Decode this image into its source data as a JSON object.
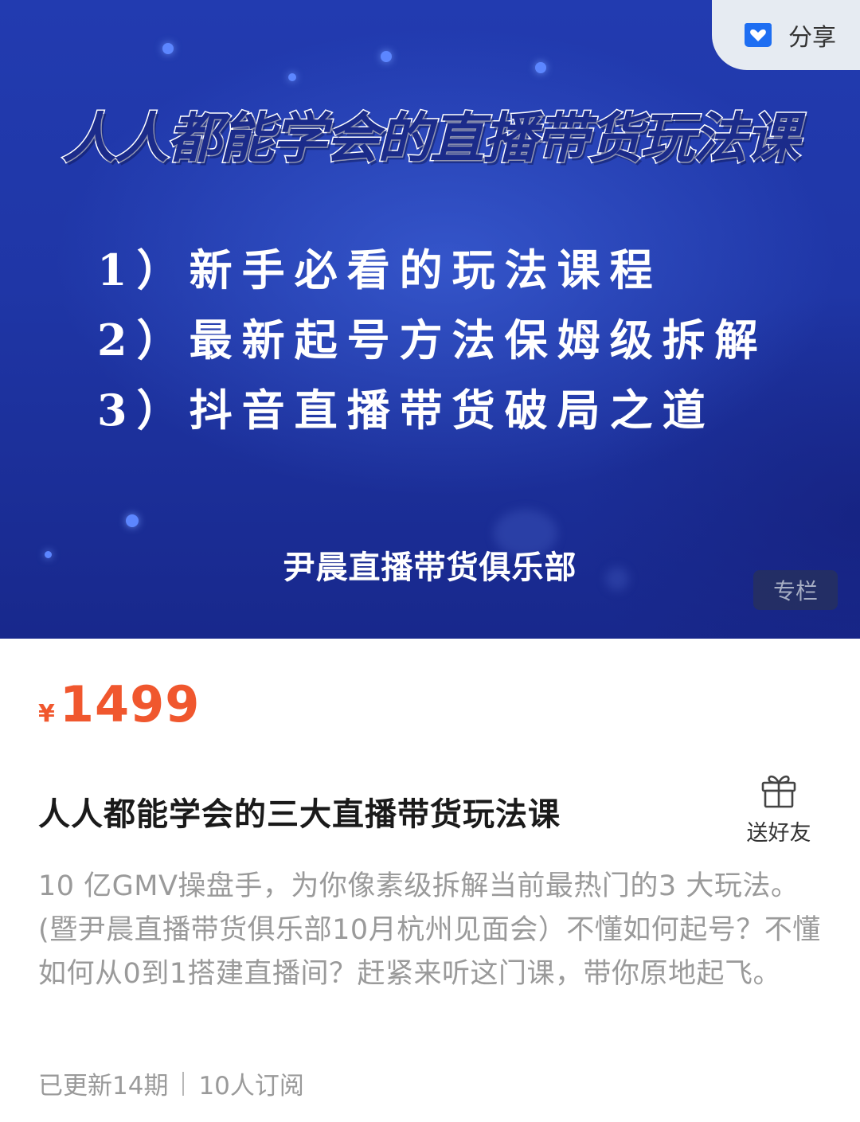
{
  "banner": {
    "title": "人人都能学会的直播带货玩法课",
    "points": [
      "1）新手必看的玩法课程",
      "2）最新起号方法保姆级拆解",
      "3）抖音直播带货破局之道"
    ],
    "club": "尹晨直播带货俱乐部",
    "tag": "专栏"
  },
  "share": {
    "label": "分享",
    "icon": "share-heart-icon"
  },
  "price": {
    "currency": "¥",
    "value": "1499"
  },
  "course": {
    "title": "人人都能学会的三大直播带货玩法课",
    "gift_label": "送好友",
    "gift_icon": "gift-icon",
    "description": "10 亿GMV操盘手，为你像素级拆解当前最热门的3 大玩法。(暨尹晨直播带货俱乐部10月杭州见面会）不懂如何起号？不懂如何从0到1搭建直播间？赶紧来听这门课，带你原地起飞。"
  },
  "meta": {
    "updates": "已更新14期",
    "subscribers": "10人订阅"
  },
  "colors": {
    "price": "#f0572e",
    "banner_blue": "#1f36a6",
    "share_icon": "#1e6ef2"
  }
}
